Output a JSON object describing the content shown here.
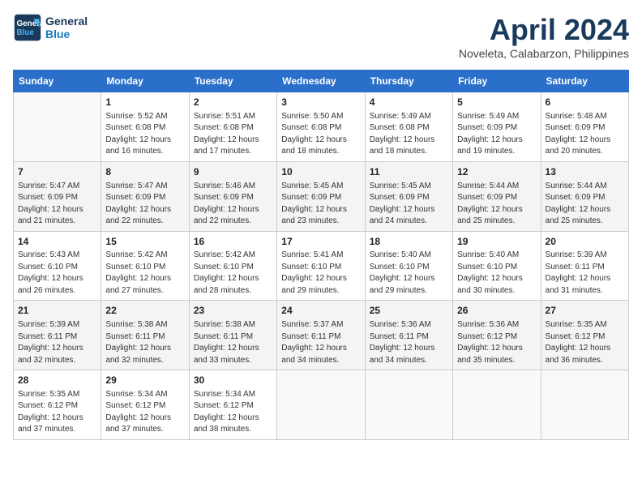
{
  "header": {
    "logo_line1": "General",
    "logo_line2": "Blue",
    "title": "April 2024",
    "subtitle": "Noveleta, Calabarzon, Philippines"
  },
  "weekdays": [
    "Sunday",
    "Monday",
    "Tuesday",
    "Wednesday",
    "Thursday",
    "Friday",
    "Saturday"
  ],
  "weeks": [
    [
      {
        "day": "",
        "info": ""
      },
      {
        "day": "1",
        "info": "Sunrise: 5:52 AM\nSunset: 6:08 PM\nDaylight: 12 hours\nand 16 minutes."
      },
      {
        "day": "2",
        "info": "Sunrise: 5:51 AM\nSunset: 6:08 PM\nDaylight: 12 hours\nand 17 minutes."
      },
      {
        "day": "3",
        "info": "Sunrise: 5:50 AM\nSunset: 6:08 PM\nDaylight: 12 hours\nand 18 minutes."
      },
      {
        "day": "4",
        "info": "Sunrise: 5:49 AM\nSunset: 6:08 PM\nDaylight: 12 hours\nand 18 minutes."
      },
      {
        "day": "5",
        "info": "Sunrise: 5:49 AM\nSunset: 6:09 PM\nDaylight: 12 hours\nand 19 minutes."
      },
      {
        "day": "6",
        "info": "Sunrise: 5:48 AM\nSunset: 6:09 PM\nDaylight: 12 hours\nand 20 minutes."
      }
    ],
    [
      {
        "day": "7",
        "info": "Sunrise: 5:47 AM\nSunset: 6:09 PM\nDaylight: 12 hours\nand 21 minutes."
      },
      {
        "day": "8",
        "info": "Sunrise: 5:47 AM\nSunset: 6:09 PM\nDaylight: 12 hours\nand 22 minutes."
      },
      {
        "day": "9",
        "info": "Sunrise: 5:46 AM\nSunset: 6:09 PM\nDaylight: 12 hours\nand 22 minutes."
      },
      {
        "day": "10",
        "info": "Sunrise: 5:45 AM\nSunset: 6:09 PM\nDaylight: 12 hours\nand 23 minutes."
      },
      {
        "day": "11",
        "info": "Sunrise: 5:45 AM\nSunset: 6:09 PM\nDaylight: 12 hours\nand 24 minutes."
      },
      {
        "day": "12",
        "info": "Sunrise: 5:44 AM\nSunset: 6:09 PM\nDaylight: 12 hours\nand 25 minutes."
      },
      {
        "day": "13",
        "info": "Sunrise: 5:44 AM\nSunset: 6:09 PM\nDaylight: 12 hours\nand 25 minutes."
      }
    ],
    [
      {
        "day": "14",
        "info": "Sunrise: 5:43 AM\nSunset: 6:10 PM\nDaylight: 12 hours\nand 26 minutes."
      },
      {
        "day": "15",
        "info": "Sunrise: 5:42 AM\nSunset: 6:10 PM\nDaylight: 12 hours\nand 27 minutes."
      },
      {
        "day": "16",
        "info": "Sunrise: 5:42 AM\nSunset: 6:10 PM\nDaylight: 12 hours\nand 28 minutes."
      },
      {
        "day": "17",
        "info": "Sunrise: 5:41 AM\nSunset: 6:10 PM\nDaylight: 12 hours\nand 29 minutes."
      },
      {
        "day": "18",
        "info": "Sunrise: 5:40 AM\nSunset: 6:10 PM\nDaylight: 12 hours\nand 29 minutes."
      },
      {
        "day": "19",
        "info": "Sunrise: 5:40 AM\nSunset: 6:10 PM\nDaylight: 12 hours\nand 30 minutes."
      },
      {
        "day": "20",
        "info": "Sunrise: 5:39 AM\nSunset: 6:11 PM\nDaylight: 12 hours\nand 31 minutes."
      }
    ],
    [
      {
        "day": "21",
        "info": "Sunrise: 5:39 AM\nSunset: 6:11 PM\nDaylight: 12 hours\nand 32 minutes."
      },
      {
        "day": "22",
        "info": "Sunrise: 5:38 AM\nSunset: 6:11 PM\nDaylight: 12 hours\nand 32 minutes."
      },
      {
        "day": "23",
        "info": "Sunrise: 5:38 AM\nSunset: 6:11 PM\nDaylight: 12 hours\nand 33 minutes."
      },
      {
        "day": "24",
        "info": "Sunrise: 5:37 AM\nSunset: 6:11 PM\nDaylight: 12 hours\nand 34 minutes."
      },
      {
        "day": "25",
        "info": "Sunrise: 5:36 AM\nSunset: 6:11 PM\nDaylight: 12 hours\nand 34 minutes."
      },
      {
        "day": "26",
        "info": "Sunrise: 5:36 AM\nSunset: 6:12 PM\nDaylight: 12 hours\nand 35 minutes."
      },
      {
        "day": "27",
        "info": "Sunrise: 5:35 AM\nSunset: 6:12 PM\nDaylight: 12 hours\nand 36 minutes."
      }
    ],
    [
      {
        "day": "28",
        "info": "Sunrise: 5:35 AM\nSunset: 6:12 PM\nDaylight: 12 hours\nand 37 minutes."
      },
      {
        "day": "29",
        "info": "Sunrise: 5:34 AM\nSunset: 6:12 PM\nDaylight: 12 hours\nand 37 minutes."
      },
      {
        "day": "30",
        "info": "Sunrise: 5:34 AM\nSunset: 6:12 PM\nDaylight: 12 hours\nand 38 minutes."
      },
      {
        "day": "",
        "info": ""
      },
      {
        "day": "",
        "info": ""
      },
      {
        "day": "",
        "info": ""
      },
      {
        "day": "",
        "info": ""
      }
    ]
  ]
}
